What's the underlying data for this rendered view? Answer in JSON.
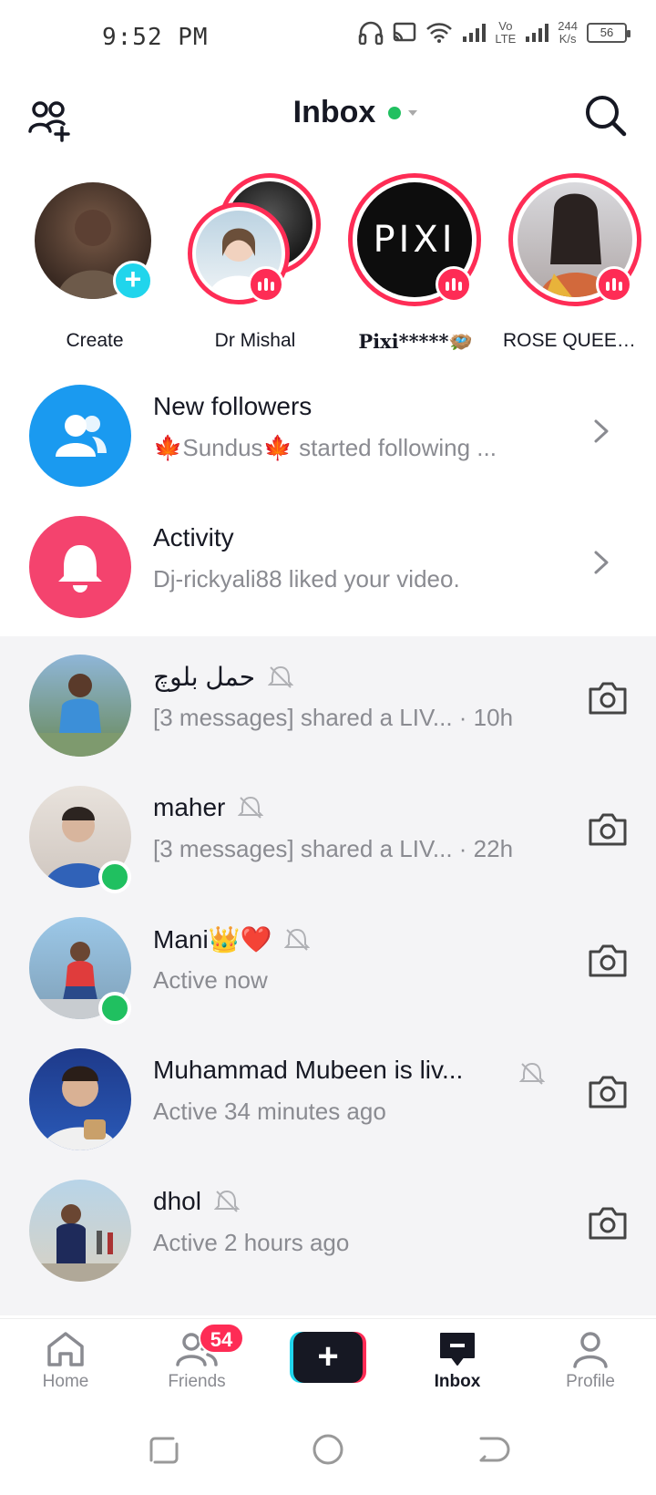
{
  "status_bar": {
    "time": "9:52 PM",
    "net_speed_value": "244",
    "net_speed_unit": "K/s",
    "network_label_top": "Vo",
    "network_label_bottom": "LTE",
    "battery": "56"
  },
  "header": {
    "title": "Inbox"
  },
  "stories": [
    {
      "label": "Create"
    },
    {
      "label": "Dr Mishal"
    },
    {
      "label": "Pixi*****🪺",
      "logo_text": "PIXI"
    },
    {
      "label": "ROSE QUEEN ..."
    }
  ],
  "system_rows": [
    {
      "title": "New followers",
      "subtitle_name": "Sundus",
      "subtitle_rest": " started following ...",
      "icon": "followers-icon",
      "color": "#1a9af0"
    },
    {
      "title": "Activity",
      "subtitle": "Dj-rickyali88 liked your video.",
      "icon": "bell-icon",
      "color": "#f4436e"
    }
  ],
  "conversations": [
    {
      "name": "حمل بلوچ",
      "subtitle": "[3 messages] shared a LIV...  · 10h",
      "online": false
    },
    {
      "name": "maher",
      "subtitle": "[3 messages] shared a LIV...  · 22h",
      "online": true
    },
    {
      "name": "Mani👑❤️",
      "subtitle": "Active now",
      "online": true
    },
    {
      "name": "Muhammad Mubeen is liv...",
      "subtitle": "Active 34 minutes ago",
      "online": false
    },
    {
      "name": "dhol",
      "subtitle": "Active 2 hours ago",
      "online": false
    }
  ],
  "bottom_nav": {
    "home": "Home",
    "friends": "Friends",
    "friends_badge": "54",
    "create": "+",
    "inbox": "Inbox",
    "profile": "Profile"
  },
  "colors": {
    "accent": "#fe2c55",
    "cyan": "#20d5ec",
    "online": "#20c060"
  }
}
